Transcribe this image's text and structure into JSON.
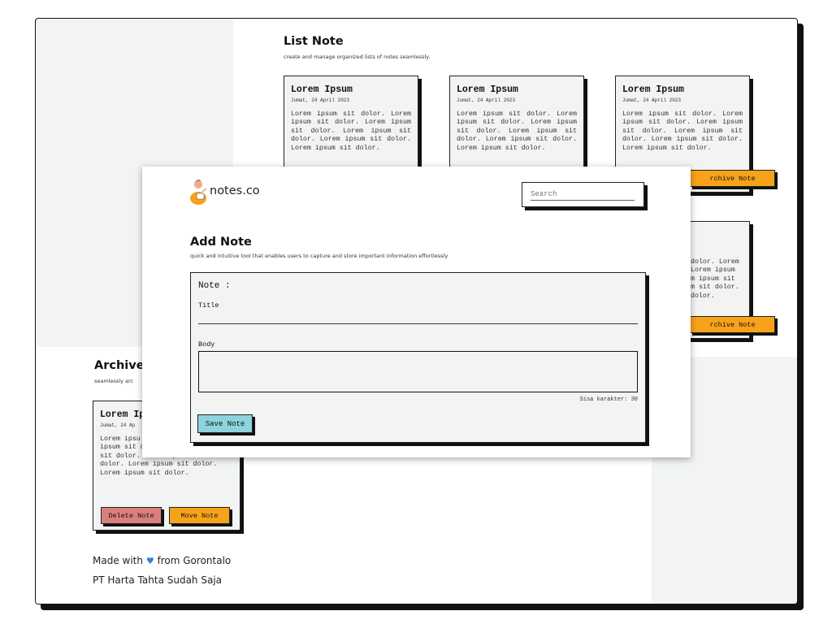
{
  "list_section": {
    "title": "List Note",
    "subtitle": "create and manage organized lists of notes seamlessly.",
    "notes": [
      {
        "title": "Lorem Ipsum",
        "date": "Jumat, 24 April 2023",
        "body": "Lorem ipsum sit dolor. Lorem ipsum sit dolor. Lorem ipsum sit dolor. Lorem ipsum sit dolor. Lorem ipsum sit dolor. Lorem ipsum sit dolor."
      },
      {
        "title": "Lorem Ipsum",
        "date": "Jumat, 24 April 2023",
        "body": "Lorem ipsum sit dolor. Lorem ipsum sit dolor. Lorem ipsum sit dolor. Lorem ipsum sit dolor. Lorem ipsum sit dolor. Lorem ipsum sit dolor."
      },
      {
        "title": "Lorem Ipsum",
        "date": "Jumat, 24 April 2023",
        "body": "Lorem ipsum sit dolor. Lorem ipsum sit dolor. Lorem ipsum sit dolor. Lorem ipsum sit dolor. Lorem ipsum sit dolor. Lorem ipsum sit dolor.",
        "archive_label": "Archive Note"
      },
      {
        "body_visible": "dolor. Lorem\nLorem ipsum\nm ipsum sit\nm sit dolor.\ndolor.",
        "archive_label": "Archive Note"
      }
    ],
    "archive_label_partial": "rchive Note"
  },
  "archive_section": {
    "title": "Archive",
    "subtitle": "seamlessly arc",
    "note": {
      "title": "Lorem Ip",
      "date": "Jumat, 24 Ap",
      "body": "Lorem ipsu\nipsum sit dolor. Lorem ipsum\nsit dolor. Lorem ipsum sit\ndolor. Lorem ipsum sit dolor.\nLorem ipsum sit dolor.",
      "delete_label": "Delete Note",
      "move_label": "Move Note"
    }
  },
  "footer": {
    "made_with": "Made with",
    "from": "from Gorontalo",
    "company": "PT Harta Tahta Sudah Saja"
  },
  "header": {
    "logo_text": "notes.co",
    "search_placeholder": "Search"
  },
  "add_note": {
    "title": "Add Note",
    "subtitle": "quick and intuitive tool that enables users to capture and store important information effortlessly",
    "form_label": "Note :",
    "title_label": "Title",
    "body_label": "Body",
    "char_counter": "Sisa karakter: 30",
    "save_label": "Save Note"
  },
  "colors": {
    "accent_orange": "#f7a21b",
    "delete_red": "#db7f7d",
    "save_teal": "#8dd3dd",
    "card_bg": "#f1f4f2",
    "heart_blue": "#2a7de1"
  },
  "icons": [
    "logo-figure-icon",
    "heart-icon"
  ]
}
